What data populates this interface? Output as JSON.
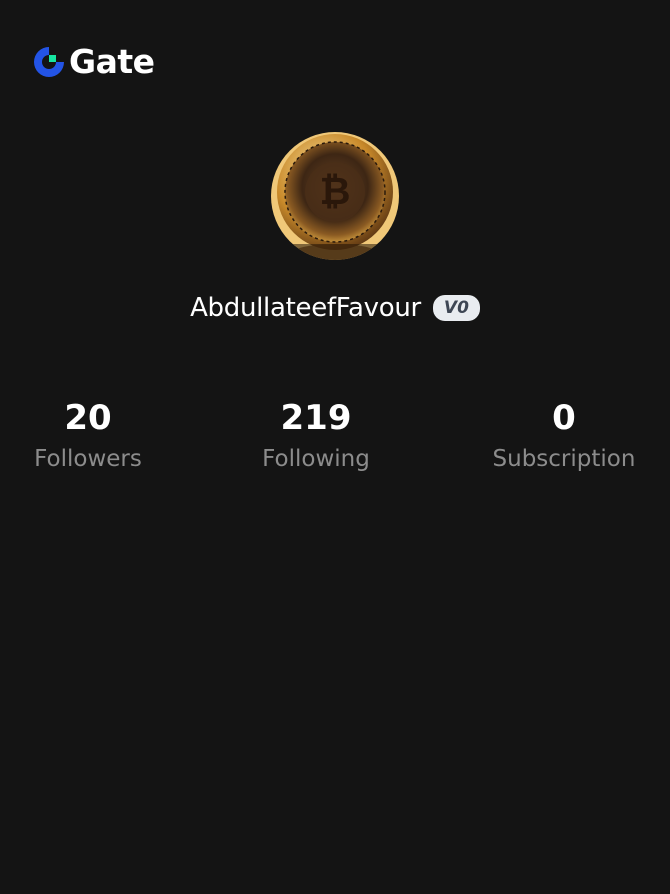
{
  "brand": {
    "name": "Gate",
    "logo_icon": "gate-logo-icon",
    "colors": {
      "mark_blue": "#2354E6",
      "mark_green": "#17E6A1",
      "background": "#141414"
    }
  },
  "profile": {
    "avatar_icon": "bitcoin-coin-avatar",
    "username": "AbdullateefFavour",
    "level_badge": "V0"
  },
  "stats": [
    {
      "value": "20",
      "label": "Followers"
    },
    {
      "value": "219",
      "label": "Following"
    },
    {
      "value": "0",
      "label": "Subscription"
    }
  ]
}
